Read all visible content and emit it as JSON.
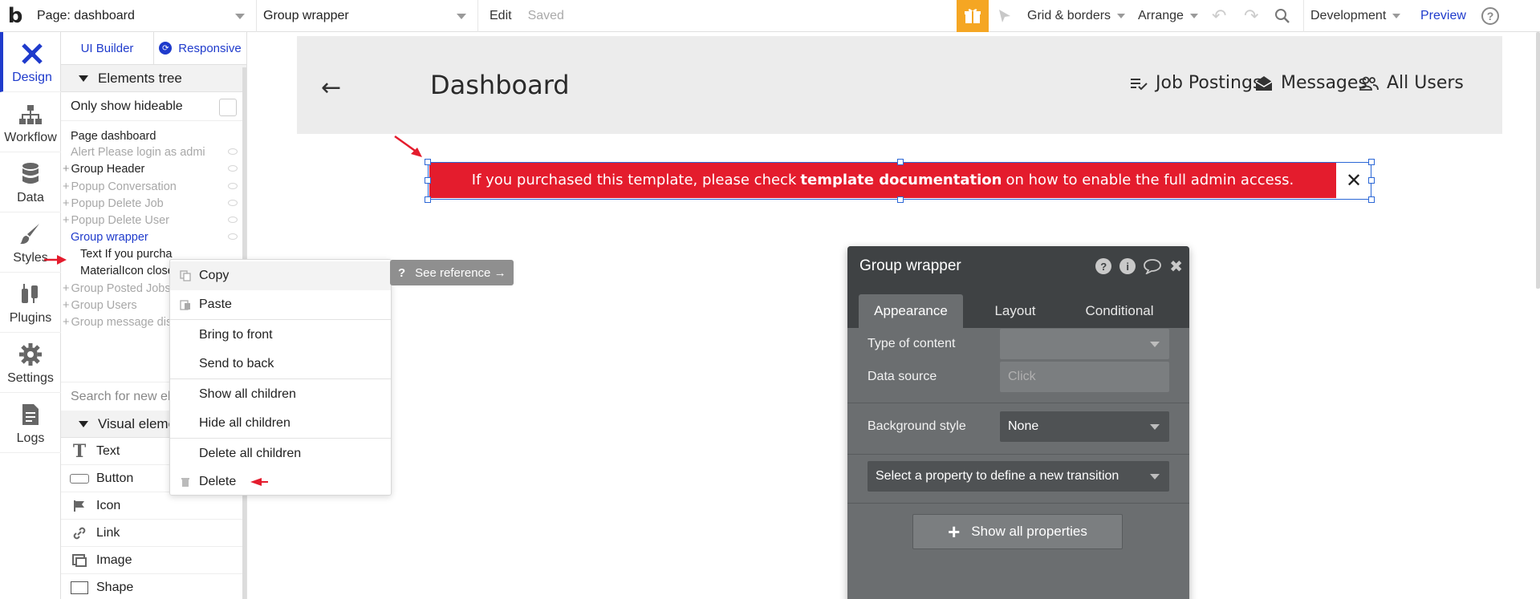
{
  "topbar": {
    "page_select": "Page: dashboard",
    "element_select": "Group wrapper",
    "edit": "Edit",
    "saved": "Saved",
    "grid_borders": "Grid & borders",
    "arrange": "Arrange",
    "environment": "Development",
    "preview": "Preview",
    "help": "?",
    "logo": "b",
    "accent": "#f5a623"
  },
  "rail": {
    "items": [
      {
        "label": "Design",
        "icon": "design-icon"
      },
      {
        "label": "Workflow",
        "icon": "workflow-icon"
      },
      {
        "label": "Data",
        "icon": "database-icon"
      },
      {
        "label": "Styles",
        "icon": "brush-icon"
      },
      {
        "label": "Plugins",
        "icon": "plug-icon"
      },
      {
        "label": "Settings",
        "icon": "gear-icon"
      },
      {
        "label": "Logs",
        "icon": "document-icon"
      }
    ]
  },
  "panel": {
    "tab_ui_builder": "UI Builder",
    "tab_responsive": "Responsive",
    "elements_tree": "Elements tree",
    "only_show_hideable": "Only show hideable",
    "tree": [
      {
        "label": "Page dashboard"
      },
      {
        "label": "Alert Please login as admi"
      },
      {
        "label": "Group Header"
      },
      {
        "label": "Popup Conversation"
      },
      {
        "label": "Popup Delete Job"
      },
      {
        "label": "Popup Delete User"
      },
      {
        "label": "Group wrapper"
      },
      {
        "label": "Text If you purcha"
      },
      {
        "label": "MaterialIcon close"
      },
      {
        "label": "Group Posted Jobs"
      },
      {
        "label": "Group Users"
      },
      {
        "label": "Group message dis"
      }
    ],
    "search_placeholder": "Search for new ele",
    "visual_elements": "Visual eleme",
    "visual_list": [
      {
        "label": "Text",
        "icon": "text-icon"
      },
      {
        "label": "Button",
        "icon": "button-icon"
      },
      {
        "label": "Icon",
        "icon": "flag-icon"
      },
      {
        "label": "Link",
        "icon": "link-icon"
      },
      {
        "label": "Image",
        "icon": "image-icon"
      },
      {
        "label": "Shape",
        "icon": "shape-icon"
      }
    ]
  },
  "canvas": {
    "back": "←",
    "title": "Dashboard",
    "nav": [
      "Job Postings",
      "Messages",
      "All Users"
    ],
    "alert_before": "If you purchased this template, please check",
    "alert_bold": "template documentation",
    "alert_after": "on how to enable the full admin access.",
    "alert_color": "#e41c2d",
    "close": "✕"
  },
  "context_menu": {
    "items": [
      "Copy",
      "Paste",
      "Bring to front",
      "Send to back",
      "Show all children",
      "Hide all children",
      "Delete all children",
      "Delete"
    ]
  },
  "see_reference": "See reference →",
  "property_editor": {
    "title": "Group wrapper",
    "tabs": [
      "Appearance",
      "Layout",
      "Conditional"
    ],
    "type_of_content_label": "Type of content",
    "type_of_content_value": "",
    "data_source_label": "Data source",
    "data_source_placeholder": "Click",
    "background_style_label": "Background style",
    "background_style_value": "None",
    "transition_select": "Select a property to define a new transition",
    "show_all": "Show all properties"
  }
}
